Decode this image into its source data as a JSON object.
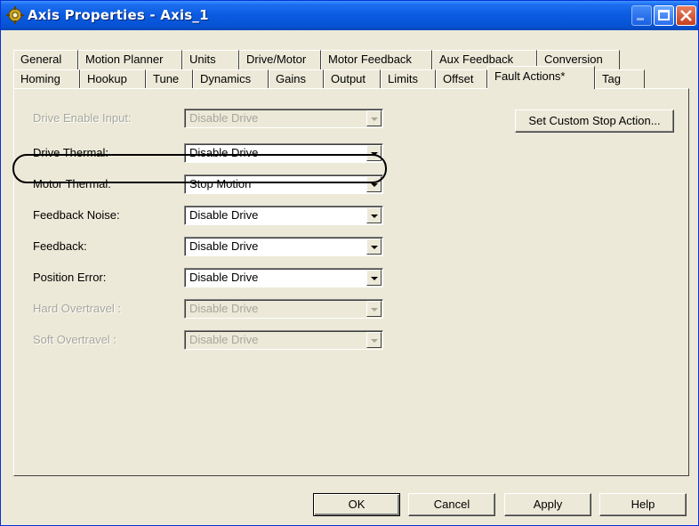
{
  "window": {
    "title": "Axis Properties - Axis_1",
    "icon": "gear-icon"
  },
  "tabs": {
    "row1": [
      "General",
      "Motion Planner",
      "Units",
      "Drive/Motor",
      "Motor Feedback",
      "Aux Feedback",
      "Conversion"
    ],
    "row2": [
      "Homing",
      "Hookup",
      "Tune",
      "Dynamics",
      "Gains",
      "Output",
      "Limits",
      "Offset",
      "Fault Actions*",
      "Tag"
    ],
    "active": "Fault Actions*"
  },
  "fault_actions": [
    {
      "label": "Drive Enable Input:",
      "value": "Disable Drive",
      "enabled": false
    },
    {
      "label": "Drive Thermal:",
      "value": "Disable Drive",
      "enabled": true
    },
    {
      "label": "Motor Thermal:",
      "value": "Stop Motion",
      "enabled": true,
      "highlighted": true
    },
    {
      "label": "Feedback Noise:",
      "value": "Disable Drive",
      "enabled": true
    },
    {
      "label": "Feedback:",
      "value": "Disable Drive",
      "enabled": true
    },
    {
      "label": "Position Error:",
      "value": "Disable Drive",
      "enabled": true
    },
    {
      "label": "Hard Overtravel :",
      "value": "Disable Drive",
      "enabled": false
    },
    {
      "label": "Soft Overtravel :",
      "value": "Disable Drive",
      "enabled": false
    }
  ],
  "custom_stop_button": "Set Custom Stop Action...",
  "footer": {
    "ok": "OK",
    "cancel": "Cancel",
    "apply": "Apply",
    "help": "Help"
  }
}
